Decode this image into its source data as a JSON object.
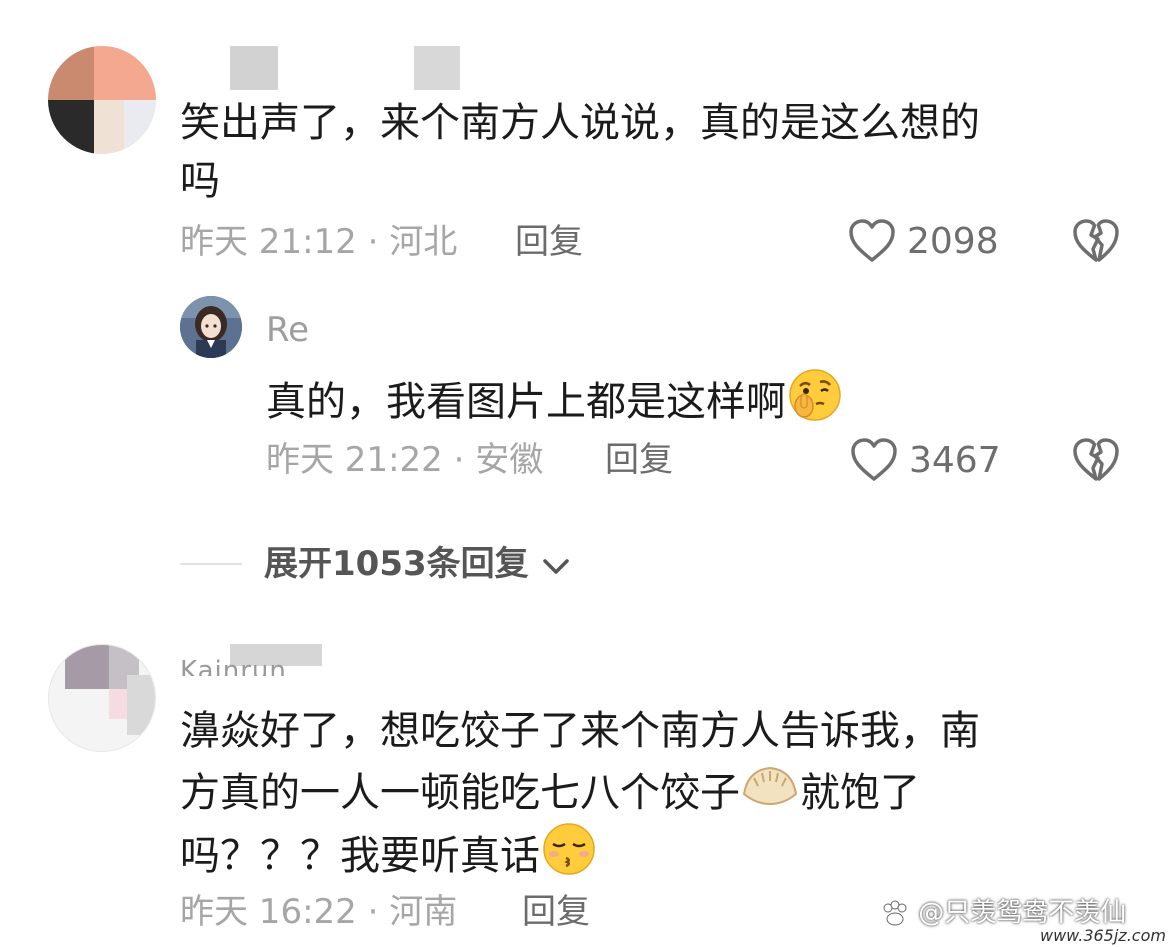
{
  "comment1": {
    "text_line1": "笑出声了，来个南方人说说，真的是这么想的",
    "text_line2": "吗",
    "meta": "昨天 21:12 · 河北",
    "reply_label": "回复",
    "like_count": "2098"
  },
  "reply1": {
    "username": "Re",
    "text": "真的，我看图片上都是这样啊",
    "emoji": "shushing-thinking-face",
    "meta": "昨天 21:22 · 安徽",
    "reply_label": "回复",
    "like_count": "3467"
  },
  "expand": {
    "label": "展开1053条回复"
  },
  "comment2": {
    "username_partial": "Kainrun",
    "text_line1": "濞焱好了，想吃饺子了来个南方人告诉我，南",
    "text_line2_a": "方真的一人一顿能吃七八个饺子",
    "text_line2_b": "就饱了",
    "text_line3_a": "吗？？？我要听真话",
    "emoji_dumpling": "dumpling",
    "emoji_face": "kissing-closed-eyes-face",
    "meta": "昨天 16:22 · 河南",
    "reply_label": "回复"
  },
  "watermark": {
    "text": "@只羡鸳鸯不羡仙",
    "site": "www.365jz.com"
  },
  "colors": {
    "text": "#1b1b1b",
    "meta": "#a6a6a6",
    "icon": "#6e6e6e"
  }
}
